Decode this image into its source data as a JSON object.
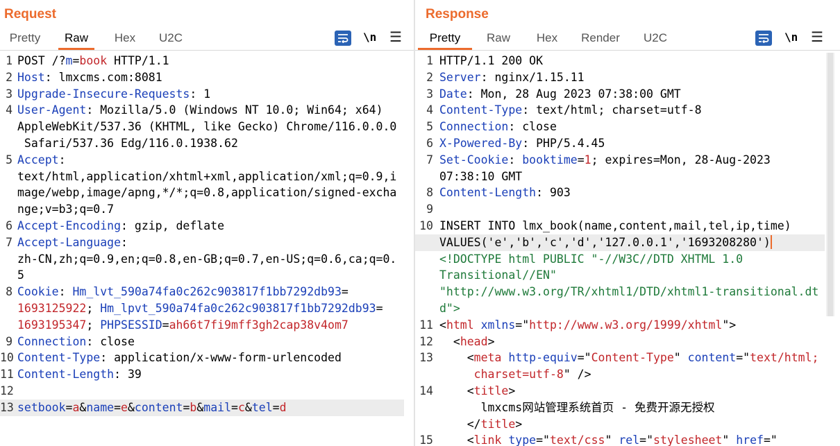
{
  "request": {
    "title": "Request",
    "tabs": [
      "Pretty",
      "Raw",
      "Hex",
      "U2C"
    ],
    "active_tab": "Raw",
    "tools": {
      "wrap_icon": "wrap-lines-icon",
      "newline_label": "\\n",
      "menu_icon": "hamburger-menu-icon"
    },
    "lines": [
      {
        "n": "1",
        "segs": [
          [
            "v",
            "POST /?"
          ],
          [
            "k",
            "m"
          ],
          [
            "v",
            "="
          ],
          [
            "r",
            "book"
          ],
          [
            "v",
            " HTTP/1.1"
          ]
        ]
      },
      {
        "n": "2",
        "segs": [
          [
            "k",
            "Host"
          ],
          [
            "v",
            ": lmxcms.com:8081"
          ]
        ]
      },
      {
        "n": "3",
        "segs": [
          [
            "k",
            "Upgrade-Insecure-Requests"
          ],
          [
            "v",
            ": 1"
          ]
        ]
      },
      {
        "n": "4",
        "segs": [
          [
            "k",
            "User-Agent"
          ],
          [
            "v",
            ": Mozilla/5.0 (Windows NT 10.0; Win64; x64)"
          ]
        ]
      },
      {
        "n": "",
        "segs": [
          [
            "v",
            "AppleWebKit/537.36 (KHTML, like Gecko) Chrome/116.0.0.0"
          ]
        ]
      },
      {
        "n": "",
        "segs": [
          [
            "v",
            " Safari/537.36 Edg/116.0.1938.62"
          ]
        ]
      },
      {
        "n": "5",
        "segs": [
          [
            "k",
            "Accept"
          ],
          [
            "v",
            ":"
          ]
        ]
      },
      {
        "n": "",
        "segs": [
          [
            "v",
            "text/html,application/xhtml+xml,application/xml;q=0.9,i"
          ]
        ]
      },
      {
        "n": "",
        "segs": [
          [
            "v",
            "mage/webp,image/apng,*/*;q=0.8,application/signed-excha"
          ]
        ]
      },
      {
        "n": "",
        "segs": [
          [
            "v",
            "nge;v=b3;q=0.7"
          ]
        ]
      },
      {
        "n": "6",
        "segs": [
          [
            "k",
            "Accept-Encoding"
          ],
          [
            "v",
            ": gzip, deflate"
          ]
        ]
      },
      {
        "n": "7",
        "segs": [
          [
            "k",
            "Accept-Language"
          ],
          [
            "v",
            ":"
          ]
        ]
      },
      {
        "n": "",
        "segs": [
          [
            "v",
            "zh-CN,zh;q=0.9,en;q=0.8,en-GB;q=0.7,en-US;q=0.6,ca;q=0."
          ]
        ]
      },
      {
        "n": "",
        "segs": [
          [
            "v",
            "5"
          ]
        ]
      },
      {
        "n": "8",
        "segs": [
          [
            "k",
            "Cookie"
          ],
          [
            "v",
            ": "
          ],
          [
            "k",
            "Hm_lvt_590a74fa0c262c903817f1bb7292db93"
          ],
          [
            "v",
            "="
          ]
        ]
      },
      {
        "n": "",
        "segs": [
          [
            "r",
            "1693125922"
          ],
          [
            "v",
            "; "
          ],
          [
            "k",
            "Hm_lpvt_590a74fa0c262c903817f1bb7292db93"
          ],
          [
            "v",
            "="
          ]
        ]
      },
      {
        "n": "",
        "segs": [
          [
            "r",
            "1693195347"
          ],
          [
            "v",
            "; "
          ],
          [
            "k",
            "PHPSESSID"
          ],
          [
            "v",
            "="
          ],
          [
            "r",
            "ah66t7fi9mff3gh2cap38v4om7"
          ]
        ]
      },
      {
        "n": "9",
        "segs": [
          [
            "k",
            "Connection"
          ],
          [
            "v",
            ": close"
          ]
        ]
      },
      {
        "n": "10",
        "segs": [
          [
            "k",
            "Content-Type"
          ],
          [
            "v",
            ": application/x-www-form-urlencoded"
          ]
        ]
      },
      {
        "n": "11",
        "segs": [
          [
            "k",
            "Content-Length"
          ],
          [
            "v",
            ": 39"
          ]
        ]
      },
      {
        "n": "12",
        "segs": []
      },
      {
        "n": "13",
        "hl": true,
        "segs": [
          [
            "k",
            "setbook"
          ],
          [
            "v",
            "="
          ],
          [
            "r",
            "a"
          ],
          [
            "v",
            "&"
          ],
          [
            "k",
            "name"
          ],
          [
            "v",
            "="
          ],
          [
            "r",
            "e"
          ],
          [
            "v",
            "&"
          ],
          [
            "k",
            "content"
          ],
          [
            "v",
            "="
          ],
          [
            "r",
            "b"
          ],
          [
            "v",
            "&"
          ],
          [
            "k",
            "mail"
          ],
          [
            "v",
            "="
          ],
          [
            "r",
            "c"
          ],
          [
            "v",
            "&"
          ],
          [
            "k",
            "tel"
          ],
          [
            "v",
            "="
          ],
          [
            "r",
            "d"
          ]
        ]
      }
    ]
  },
  "response": {
    "title": "Response",
    "tabs": [
      "Pretty",
      "Raw",
      "Hex",
      "Render",
      "U2C"
    ],
    "active_tab": "Pretty",
    "tools": {
      "wrap_icon": "wrap-lines-icon",
      "newline_label": "\\n",
      "menu_icon": "hamburger-menu-icon"
    },
    "lines": [
      {
        "n": "1",
        "segs": [
          [
            "v",
            "HTTP/1.1 200 OK"
          ]
        ]
      },
      {
        "n": "2",
        "segs": [
          [
            "k",
            "Server"
          ],
          [
            "v",
            ": nginx/1.15.11"
          ]
        ]
      },
      {
        "n": "3",
        "segs": [
          [
            "k",
            "Date"
          ],
          [
            "v",
            ": Mon, 28 Aug 2023 07:38:00 GMT"
          ]
        ]
      },
      {
        "n": "4",
        "segs": [
          [
            "k",
            "Content-Type"
          ],
          [
            "v",
            ": text/html; charset=utf-8"
          ]
        ]
      },
      {
        "n": "5",
        "segs": [
          [
            "k",
            "Connection"
          ],
          [
            "v",
            ": close"
          ]
        ]
      },
      {
        "n": "6",
        "segs": [
          [
            "k",
            "X-Powered-By"
          ],
          [
            "v",
            ": PHP/5.4.45"
          ]
        ]
      },
      {
        "n": "7",
        "segs": [
          [
            "k",
            "Set-Cookie"
          ],
          [
            "v",
            ": "
          ],
          [
            "k",
            "booktime"
          ],
          [
            "v",
            "="
          ],
          [
            "r",
            "1"
          ],
          [
            "v",
            "; expires=Mon, 28-Aug-2023"
          ]
        ]
      },
      {
        "n": "",
        "segs": [
          [
            "v",
            "07:38:10 GMT"
          ]
        ]
      },
      {
        "n": "8",
        "segs": [
          [
            "k",
            "Content-Length"
          ],
          [
            "v",
            ": 903"
          ]
        ]
      },
      {
        "n": "9",
        "segs": []
      },
      {
        "n": "10",
        "segs": [
          [
            "v",
            "INSERT INTO lmx_book(name,content,mail,tel,ip,time)"
          ]
        ]
      },
      {
        "n": "",
        "hl": true,
        "cursor": true,
        "segs": [
          [
            "v",
            "VALUES('e','b','c','d','127.0.0.1','1693208280')"
          ]
        ]
      },
      {
        "n": "",
        "segs": [
          [
            "g",
            "<!DOCTYPE html PUBLIC \"-//W3C//DTD XHTML 1.0"
          ]
        ]
      },
      {
        "n": "",
        "segs": [
          [
            "g",
            "Transitional//EN\""
          ]
        ]
      },
      {
        "n": "",
        "segs": [
          [
            "g",
            "\"http://www.w3.org/TR/xhtml1/DTD/xhtml1-transitional.dt"
          ]
        ]
      },
      {
        "n": "",
        "segs": [
          [
            "g",
            "d\">"
          ]
        ]
      },
      {
        "n": "11",
        "segs": [
          [
            "v",
            "<"
          ],
          [
            "r",
            "html"
          ],
          [
            "v",
            " "
          ],
          [
            "k",
            "xmlns"
          ],
          [
            "v",
            "=\""
          ],
          [
            "r",
            "http://www.w3.org/1999/xhtml"
          ],
          [
            "v",
            "\">"
          ]
        ]
      },
      {
        "n": "12",
        "segs": [
          [
            "v",
            "  <"
          ],
          [
            "r",
            "head"
          ],
          [
            "v",
            ">"
          ]
        ]
      },
      {
        "n": "13",
        "segs": [
          [
            "v",
            "    <"
          ],
          [
            "r",
            "meta"
          ],
          [
            "v",
            " "
          ],
          [
            "k",
            "http-equiv"
          ],
          [
            "v",
            "=\""
          ],
          [
            "r",
            "Content-Type"
          ],
          [
            "v",
            "\" "
          ],
          [
            "k",
            "content"
          ],
          [
            "v",
            "=\""
          ],
          [
            "r",
            "text/html;"
          ]
        ]
      },
      {
        "n": "",
        "segs": [
          [
            "r",
            "     charset=utf-8"
          ],
          [
            "v",
            "\" />"
          ]
        ]
      },
      {
        "n": "14",
        "segs": [
          [
            "v",
            "    <"
          ],
          [
            "r",
            "title"
          ],
          [
            "v",
            ">"
          ]
        ]
      },
      {
        "n": "",
        "segs": [
          [
            "v",
            "      lmxcms网站管理系统首页 - 免费开源无授权"
          ]
        ]
      },
      {
        "n": "",
        "segs": [
          [
            "v",
            "    </"
          ],
          [
            "r",
            "title"
          ],
          [
            "v",
            ">"
          ]
        ]
      },
      {
        "n": "15",
        "segs": [
          [
            "v",
            "    <"
          ],
          [
            "r",
            "link"
          ],
          [
            "v",
            " "
          ],
          [
            "k",
            "type"
          ],
          [
            "v",
            "=\""
          ],
          [
            "r",
            "text/css"
          ],
          [
            "v",
            "\" "
          ],
          [
            "k",
            "rel"
          ],
          [
            "v",
            "=\""
          ],
          [
            "r",
            "stylesheet"
          ],
          [
            "v",
            "\" "
          ],
          [
            "k",
            "href"
          ],
          [
            "v",
            "=\""
          ]
        ]
      }
    ]
  },
  "layout_buttons": [
    "split-horizontal-icon",
    "split-vertical-icon",
    "single-pane-icon"
  ]
}
